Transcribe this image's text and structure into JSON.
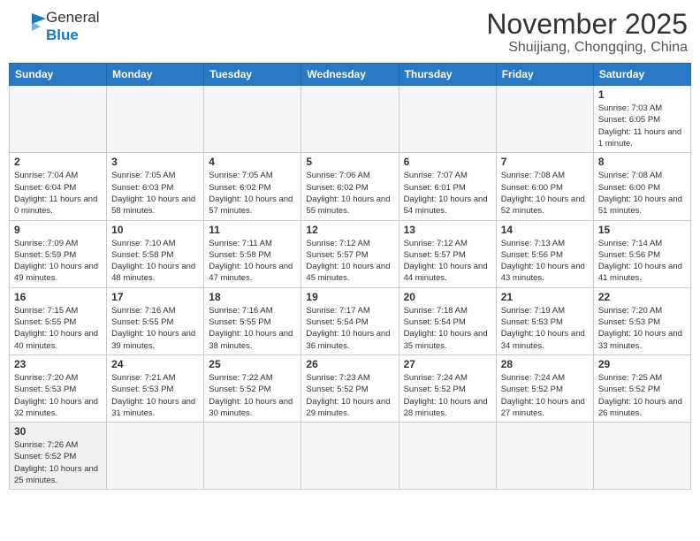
{
  "logo": {
    "text_general": "General",
    "text_blue": "Blue"
  },
  "header": {
    "month_year": "November 2025",
    "location": "Shuijiang, Chongqing, China"
  },
  "weekdays": [
    "Sunday",
    "Monday",
    "Tuesday",
    "Wednesday",
    "Thursday",
    "Friday",
    "Saturday"
  ],
  "weeks": [
    [
      {
        "day": "",
        "info": ""
      },
      {
        "day": "",
        "info": ""
      },
      {
        "day": "",
        "info": ""
      },
      {
        "day": "",
        "info": ""
      },
      {
        "day": "",
        "info": ""
      },
      {
        "day": "",
        "info": ""
      },
      {
        "day": "1",
        "info": "Sunrise: 7:03 AM\nSunset: 6:05 PM\nDaylight: 11 hours and 1 minute."
      }
    ],
    [
      {
        "day": "2",
        "info": "Sunrise: 7:04 AM\nSunset: 6:04 PM\nDaylight: 11 hours and 0 minutes."
      },
      {
        "day": "3",
        "info": "Sunrise: 7:05 AM\nSunset: 6:03 PM\nDaylight: 10 hours and 58 minutes."
      },
      {
        "day": "4",
        "info": "Sunrise: 7:05 AM\nSunset: 6:02 PM\nDaylight: 10 hours and 57 minutes."
      },
      {
        "day": "5",
        "info": "Sunrise: 7:06 AM\nSunset: 6:02 PM\nDaylight: 10 hours and 55 minutes."
      },
      {
        "day": "6",
        "info": "Sunrise: 7:07 AM\nSunset: 6:01 PM\nDaylight: 10 hours and 54 minutes."
      },
      {
        "day": "7",
        "info": "Sunrise: 7:08 AM\nSunset: 6:00 PM\nDaylight: 10 hours and 52 minutes."
      },
      {
        "day": "8",
        "info": "Sunrise: 7:08 AM\nSunset: 6:00 PM\nDaylight: 10 hours and 51 minutes."
      }
    ],
    [
      {
        "day": "9",
        "info": "Sunrise: 7:09 AM\nSunset: 5:59 PM\nDaylight: 10 hours and 49 minutes."
      },
      {
        "day": "10",
        "info": "Sunrise: 7:10 AM\nSunset: 5:58 PM\nDaylight: 10 hours and 48 minutes."
      },
      {
        "day": "11",
        "info": "Sunrise: 7:11 AM\nSunset: 5:58 PM\nDaylight: 10 hours and 47 minutes."
      },
      {
        "day": "12",
        "info": "Sunrise: 7:12 AM\nSunset: 5:57 PM\nDaylight: 10 hours and 45 minutes."
      },
      {
        "day": "13",
        "info": "Sunrise: 7:12 AM\nSunset: 5:57 PM\nDaylight: 10 hours and 44 minutes."
      },
      {
        "day": "14",
        "info": "Sunrise: 7:13 AM\nSunset: 5:56 PM\nDaylight: 10 hours and 43 minutes."
      },
      {
        "day": "15",
        "info": "Sunrise: 7:14 AM\nSunset: 5:56 PM\nDaylight: 10 hours and 41 minutes."
      }
    ],
    [
      {
        "day": "16",
        "info": "Sunrise: 7:15 AM\nSunset: 5:55 PM\nDaylight: 10 hours and 40 minutes."
      },
      {
        "day": "17",
        "info": "Sunrise: 7:16 AM\nSunset: 5:55 PM\nDaylight: 10 hours and 39 minutes."
      },
      {
        "day": "18",
        "info": "Sunrise: 7:16 AM\nSunset: 5:55 PM\nDaylight: 10 hours and 38 minutes."
      },
      {
        "day": "19",
        "info": "Sunrise: 7:17 AM\nSunset: 5:54 PM\nDaylight: 10 hours and 36 minutes."
      },
      {
        "day": "20",
        "info": "Sunrise: 7:18 AM\nSunset: 5:54 PM\nDaylight: 10 hours and 35 minutes."
      },
      {
        "day": "21",
        "info": "Sunrise: 7:19 AM\nSunset: 5:53 PM\nDaylight: 10 hours and 34 minutes."
      },
      {
        "day": "22",
        "info": "Sunrise: 7:20 AM\nSunset: 5:53 PM\nDaylight: 10 hours and 33 minutes."
      }
    ],
    [
      {
        "day": "23",
        "info": "Sunrise: 7:20 AM\nSunset: 5:53 PM\nDaylight: 10 hours and 32 minutes."
      },
      {
        "day": "24",
        "info": "Sunrise: 7:21 AM\nSunset: 5:53 PM\nDaylight: 10 hours and 31 minutes."
      },
      {
        "day": "25",
        "info": "Sunrise: 7:22 AM\nSunset: 5:52 PM\nDaylight: 10 hours and 30 minutes."
      },
      {
        "day": "26",
        "info": "Sunrise: 7:23 AM\nSunset: 5:52 PM\nDaylight: 10 hours and 29 minutes."
      },
      {
        "day": "27",
        "info": "Sunrise: 7:24 AM\nSunset: 5:52 PM\nDaylight: 10 hours and 28 minutes."
      },
      {
        "day": "28",
        "info": "Sunrise: 7:24 AM\nSunset: 5:52 PM\nDaylight: 10 hours and 27 minutes."
      },
      {
        "day": "29",
        "info": "Sunrise: 7:25 AM\nSunset: 5:52 PM\nDaylight: 10 hours and 26 minutes."
      }
    ],
    [
      {
        "day": "30",
        "info": "Sunrise: 7:26 AM\nSunset: 5:52 PM\nDaylight: 10 hours and 25 minutes."
      },
      {
        "day": "",
        "info": ""
      },
      {
        "day": "",
        "info": ""
      },
      {
        "day": "",
        "info": ""
      },
      {
        "day": "",
        "info": ""
      },
      {
        "day": "",
        "info": ""
      },
      {
        "day": "",
        "info": ""
      }
    ]
  ]
}
